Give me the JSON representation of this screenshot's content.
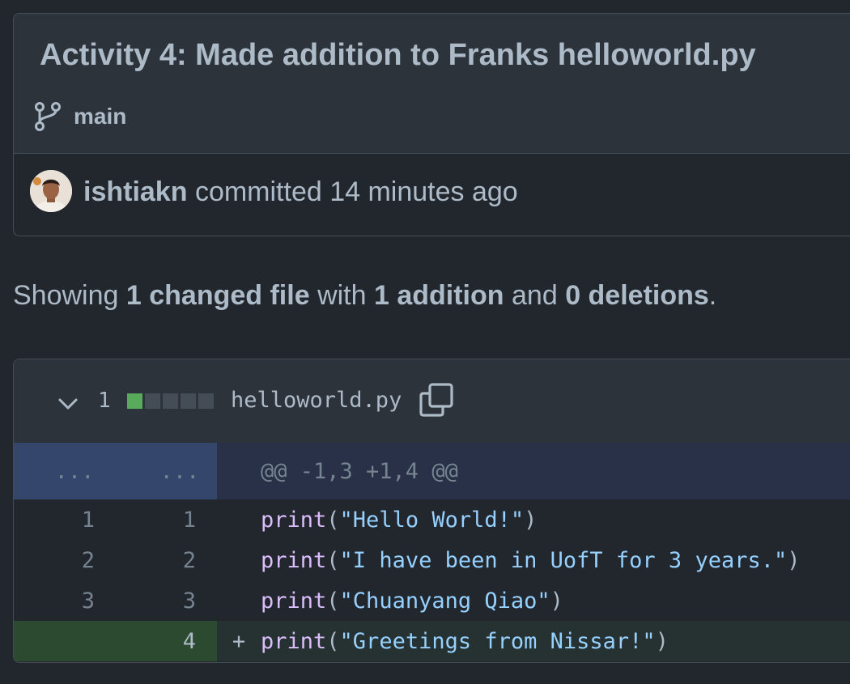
{
  "commit": {
    "title": "Activity 4: Made addition to Franks helloworld.py",
    "branch": "main",
    "author": "ishtiakn",
    "action_text": "committed",
    "time_ago": "14 minutes ago"
  },
  "summary": {
    "prefix": "Showing",
    "changed_files": "1 changed file",
    "with_text": "with",
    "additions": "1 addition",
    "and_text": "and",
    "deletions": "0 deletions",
    "suffix": "."
  },
  "file": {
    "change_count": "1",
    "diffstat": [
      "added",
      "neutral",
      "neutral",
      "neutral",
      "neutral"
    ],
    "name": "helloworld.py"
  },
  "diff": {
    "hunk": {
      "old_marker": "...",
      "new_marker": "...",
      "header": "@@ -1,3 +1,4 @@"
    },
    "lines": [
      {
        "old": "1",
        "new": "1",
        "marker": "",
        "fn": "print",
        "open": "(",
        "str": "\"Hello World!\"",
        "close": ")",
        "type": "context"
      },
      {
        "old": "2",
        "new": "2",
        "marker": "",
        "fn": "print",
        "open": "(",
        "str": "\"I have been in UofT for 3 years.\"",
        "close": ")",
        "type": "context"
      },
      {
        "old": "3",
        "new": "3",
        "marker": "",
        "fn": "print",
        "open": "(",
        "str": "\"Chuanyang Qiao\"",
        "close": ")",
        "type": "context"
      },
      {
        "old": "",
        "new": "4",
        "marker": "+",
        "fn": "print",
        "open": "(",
        "str": "\"Greetings from Nissar!\"",
        "close": ")",
        "type": "addition"
      }
    ]
  },
  "colors": {
    "background": "#22272e",
    "panel": "#2d333b",
    "border": "#444c56",
    "addition_gutter": "#2b4a30",
    "addition_line": "#263232",
    "hunk_gutter": "#34466c",
    "hunk_line": "#283147",
    "diffstat_added": "#57ab5a",
    "diffstat_neutral": "#444c56"
  }
}
